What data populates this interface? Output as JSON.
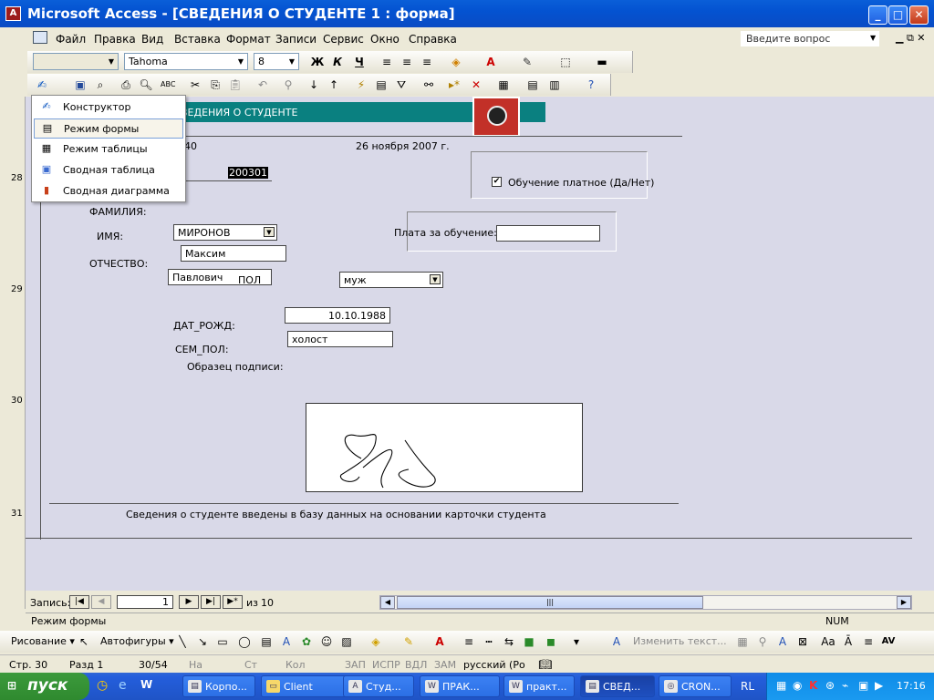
{
  "window": {
    "title": "Microsoft Access - [СВЕДЕНИЯ О СТУДЕНТЕ 1 : форма]",
    "minimize": "_",
    "maximize": "□",
    "close": "✕"
  },
  "menu": {
    "items": [
      "Файл",
      "Правка",
      "Вид",
      "Вставка",
      "Формат",
      "Записи",
      "Сервис",
      "Окно",
      "Справка"
    ],
    "ask_placeholder": "Введите вопрос"
  },
  "format_toolbar": {
    "font": "Tahoma",
    "size": "8",
    "bold": "Ж",
    "italic": "К",
    "underline": "Ч"
  },
  "popup": {
    "items": [
      "Конструктор",
      "Режим формы",
      "Режим таблицы",
      "Сводная таблица",
      "Сводная диаграмма"
    ],
    "selected_index": 1
  },
  "form": {
    "header_title": "ВЕДЕНИЯ О СТУДЕНТЕ",
    "partial_number": "40",
    "date": "26 ноября 2007 г.",
    "id_value": "200301",
    "checkbox_label": "Обучение платное (Да/Нет)",
    "checkbox_checked": true,
    "label_surname": "ФАМИЛИЯ:",
    "label_name": "ИМЯ:",
    "label_patronymic": "ОТЧЕСТВО:",
    "surname_value": "МИРОНОВ",
    "name_value": "Максим",
    "patronymic_value": "Павлович",
    "label_gender": "ПОЛ",
    "gender_value": "муж",
    "label_fee": "Плата за обучение:",
    "fee_value": "",
    "label_birth": "ДАТ_РОЖД:",
    "birth_value": "10.10.1988",
    "label_marital": "СЕМ_ПОЛ:",
    "marital_value": "холост",
    "label_signature": "Образец подписи:",
    "footer_text": "Сведения о студенте введены в базу данных на основании карточки студента"
  },
  "ruler": {
    "numbers": [
      "28",
      "29",
      "30",
      "31"
    ]
  },
  "navigation": {
    "label": "Запись:",
    "current": "1",
    "of_label": "из",
    "total": "10"
  },
  "status": {
    "mode": "Режим формы",
    "num": "NUM"
  },
  "drawing_toolbar": {
    "draw": "Рисование",
    "autoshapes": "Автофигуры",
    "edit_text": "Изменить текст..."
  },
  "word_status": {
    "page": "Стр. 30",
    "section": "Разд 1",
    "pages": "30/54",
    "at": "На",
    "line": "Ст",
    "col": "Кол",
    "rec": "ЗАП",
    "trk": "ИСПР",
    "ext": "ВДЛ",
    "ovr": "ЗАМ",
    "lang": "русский (Ро"
  },
  "taskbar": {
    "start": "пуск",
    "tasks": [
      "Корпо...",
      "Client",
      "Студ...",
      "ПРАК...",
      "практ...",
      "СВЕД...",
      "CRON..."
    ],
    "lang": "RL",
    "clock": "17:16"
  }
}
